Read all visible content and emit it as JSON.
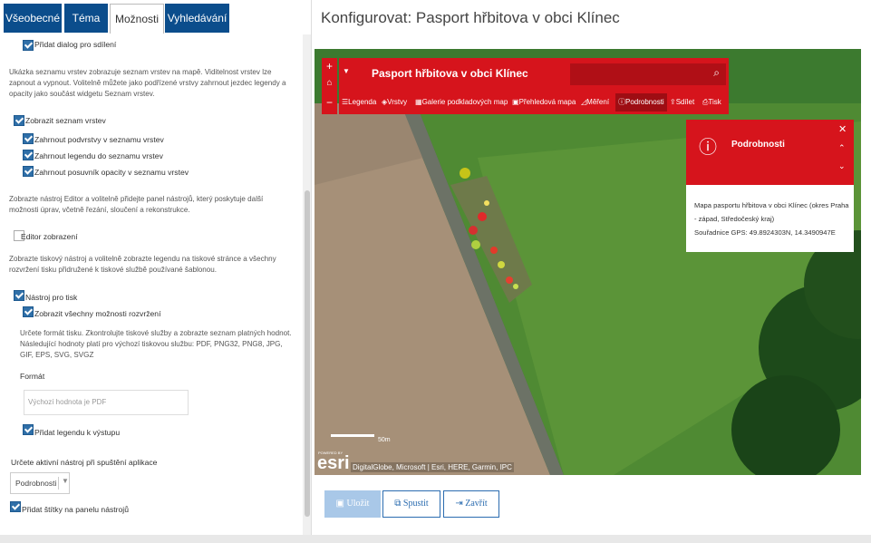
{
  "tabs": [
    {
      "label": "Všeobecné"
    },
    {
      "label": "Téma"
    },
    {
      "label": "Možnosti"
    },
    {
      "label": "Vyhledávání"
    }
  ],
  "options": {
    "share_dialog": "Přidat dialog pro sdílení",
    "layers_desc": "Ukázka seznamu vrstev zobrazuje seznam vrstev na mapě. Viditelnost vrstev lze zapnout a vypnout. Volitelně můžete jako podřízené vrstvy zahrnout jezdec legendy a opacity jako součást widgetu Seznam vrstev.",
    "show_layers": "Zobrazit seznam vrstev",
    "include_sublayers": "Zahrnout podvrstvy v seznamu vrstev",
    "include_legend": "Zahrnout legendu do seznamu vrstev",
    "include_opacity": "Zahrnout posuvník opacity v seznamu vrstev",
    "editor_desc": "Zobrazte nástroj Editor a volitelně přidejte panel nástrojů, který poskytuje další možnosti úprav, včetně řezání, sloučení a rekonstrukce.",
    "editor_toolbar": "Editor zobrazení",
    "print_desc": "Zobrazte tiskový nástroj a volitelně zobrazte legendu na tiskové stránce a všechny rozvržení tisku přidružené k tiskové službě používané šablonou.",
    "print_tool": "Nástroj pro tisk",
    "show_layouts": "Zobrazit všechny možnosti rozvržení",
    "format_desc": "Určete formát tisku. Zkontrolujte tiskové služby a zobrazte seznam platných hodnot. Následující hodnoty platí pro výchozí tiskovou službu: PDF, PNG32, PNG8, JPG, GIF, EPS, SVG, SVGZ",
    "format_label": "Formát",
    "format_placeholder": "Výchozí hodnota je PDF",
    "add_legend": "Přidat legendu k výstupu",
    "active_tool_label": "Určete aktivní nástroj při spuštění aplikace",
    "active_tool_value": "Podrobnosti",
    "add_labels": "Přidat štítky na panelu nástrojů"
  },
  "page_title": "Konfigurovat: Pasport hřbitova v obci Klínec",
  "map": {
    "title": "Pasport hřbitova v obci Klínec",
    "tools": [
      "Legenda",
      "Vrstvy",
      "Galerie podkladových map",
      "Přehledová mapa",
      "Měření",
      "Podrobnosti",
      "Sdílet",
      "Tisk"
    ],
    "popup_title": "Podrobnosti",
    "popup_text1": "Mapa pasportu hřbitova v obci Klínec (okres Praha - západ, Středočeský kraj)",
    "popup_text2": "Souřadnice GPS: 49.8924303N, 14.3490947E",
    "attribution": "DigitalGlobe, Microsoft | Esri, HERE, Garmin, IPC",
    "esri_small": "POWERED BY",
    "esri_logo": "esri",
    "scale_label": "50m"
  },
  "buttons": {
    "save": "Uložit",
    "run": "Spustit",
    "close": "Zavřít"
  },
  "colors": {
    "tab_blue": "#0b4d8c",
    "map_red": "#d6141c",
    "checkbox": "#2f6fa8"
  }
}
